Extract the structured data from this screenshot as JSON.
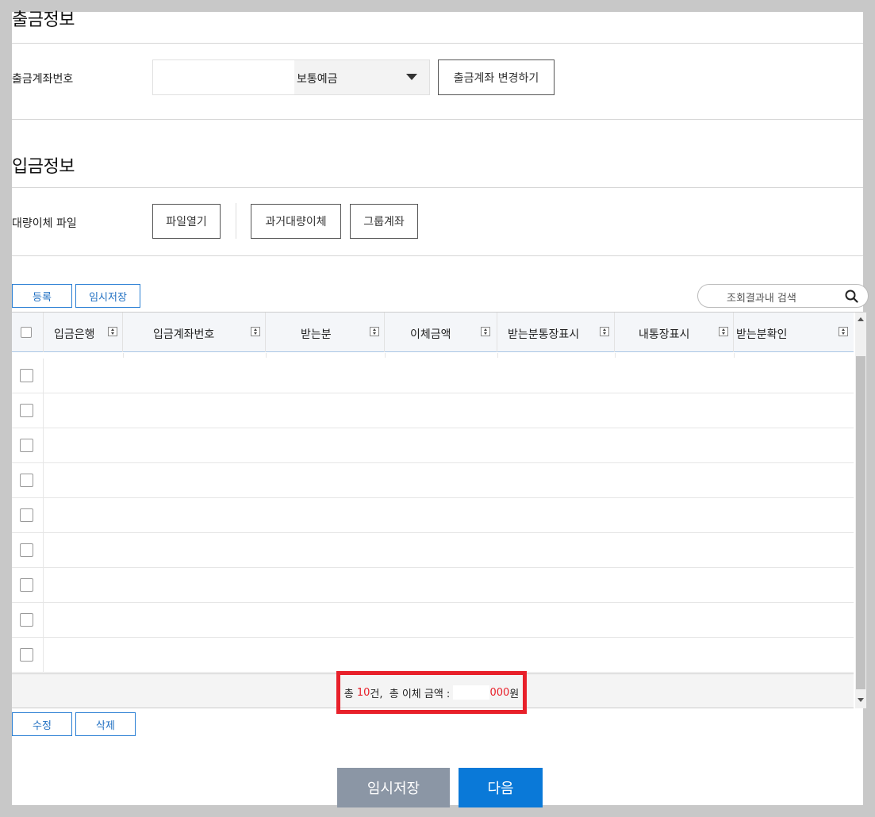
{
  "withdrawal": {
    "title": "출금정보",
    "account_label": "출금계좌번호",
    "account_type": "보통예금",
    "change_button": "출금계좌 변경하기"
  },
  "deposit": {
    "title": "입금정보",
    "bulk_label": "대량이체 파일",
    "open_file_button": "파일열기",
    "past_bulk_button": "과거대량이체",
    "group_account_button": "그룹계좌"
  },
  "toolbar": {
    "register_button": "등록",
    "temp_save_button": "임시저장",
    "search_placeholder": "조회결과내 검색"
  },
  "grid": {
    "columns": [
      "입금은행",
      "입금계좌번호",
      "받는분",
      "이체금액",
      "받는분통장표시",
      "내통장표시",
      "받는분확인"
    ],
    "row_count": 9
  },
  "summary": {
    "prefix": "총 ",
    "count": "10",
    "count_suffix": "건,  총 이체 금액 : ",
    "amount_suffix": "000",
    "won": "원"
  },
  "bottom": {
    "edit_button": "수정",
    "delete_button": "삭제",
    "temp_save_button": "임시저장",
    "next_button": "다음"
  },
  "colors": {
    "primary": "#0a79d8",
    "highlight": "#e8202a",
    "gray_button": "#8b96a5"
  }
}
